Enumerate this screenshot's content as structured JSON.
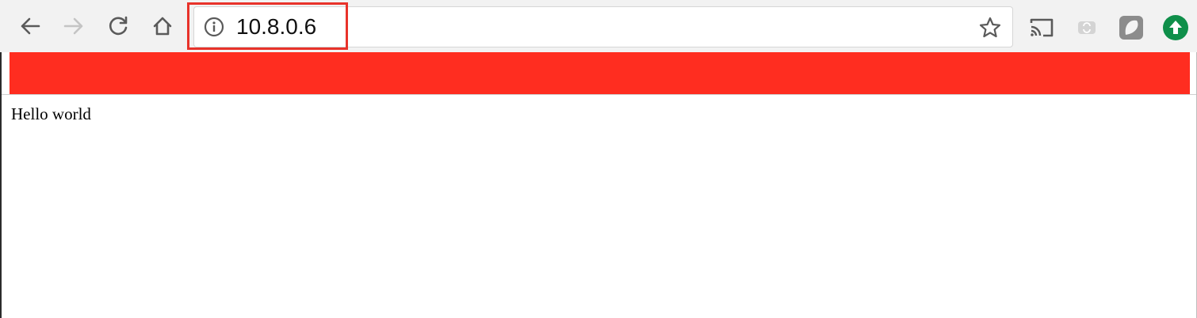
{
  "browser": {
    "address_bar": {
      "url": "10.8.0.6"
    },
    "icons": {
      "back": "arrow-left-icon",
      "forward": "arrow-right-icon",
      "reload": "reload-icon",
      "home": "home-icon",
      "site_info": "info-icon",
      "bookmark": "star-icon",
      "cast": "cast-icon",
      "extension_sync": "sync-extension-icon",
      "extension_ghost": "ghost-extension-icon",
      "extension_upload": "upload-extension-icon"
    }
  },
  "page": {
    "header_color": "#ff2d20",
    "body_text": "Hello world"
  },
  "annotation": {
    "highlight_color": "#e8322a"
  }
}
